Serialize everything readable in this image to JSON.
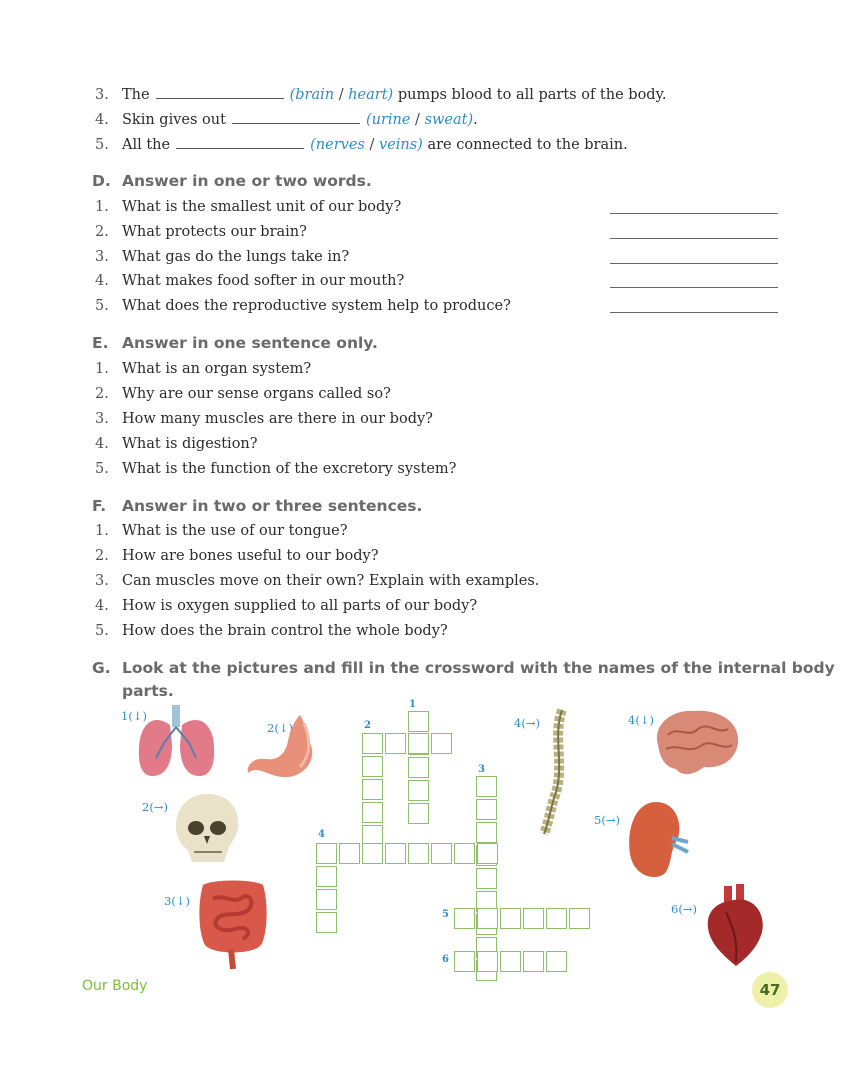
{
  "fill_blanks": [
    {
      "num": "3.",
      "pre": "The",
      "opt1": "brain",
      "opt2": "heart",
      "post": "pumps blood to all parts of the body."
    },
    {
      "num": "4.",
      "pre": "Skin gives out",
      "opt1": "urine",
      "opt2": "sweat",
      "post": "."
    },
    {
      "num": "5.",
      "pre": "All the",
      "opt1": "nerves",
      "opt2": "veins",
      "post": "are connected to the brain."
    }
  ],
  "sections": [
    {
      "letter": "D.",
      "title": "Answer in one or two words.",
      "items": [
        {
          "num": "1.",
          "text": "What is the smallest unit of our body?"
        },
        {
          "num": "2.",
          "text": "What protects our brain?"
        },
        {
          "num": "3.",
          "text": "What gas do the lungs take in?"
        },
        {
          "num": "4.",
          "text": "What makes food softer in our mouth?"
        },
        {
          "num": "5.",
          "text": "What does the reproductive system help to produce?"
        }
      ]
    },
    {
      "letter": "E.",
      "title": "Answer in one sentence only.",
      "items": [
        {
          "num": "1.",
          "text": "What is an organ system?"
        },
        {
          "num": "2.",
          "text": "Why are our sense organs called so?"
        },
        {
          "num": "3.",
          "text": "How many muscles are there in our body?"
        },
        {
          "num": "4.",
          "text": "What is digestion?"
        },
        {
          "num": "5.",
          "text": "What is the function of the excretory system?"
        }
      ]
    },
    {
      "letter": "F.",
      "title": "Answer in two or three sentences.",
      "items": [
        {
          "num": "1.",
          "text": "What is the use of our tongue?"
        },
        {
          "num": "2.",
          "text": "How are bones useful to our body?"
        },
        {
          "num": "3.",
          "text": "Can muscles move on their own? Explain with examples."
        },
        {
          "num": "4.",
          "text": "How is oxygen supplied to all parts of our body?"
        },
        {
          "num": "5.",
          "text": "How does the brain control the whole body?"
        }
      ]
    }
  ],
  "section_g": {
    "letter": "G.",
    "title_line1": "Look at the pictures and fill in the crossword with the names of the internal body",
    "title_line2": "parts."
  },
  "clues": {
    "lungs": "1(↓)",
    "stomach": "2(↓)",
    "skull": "2(→)",
    "intestine": "3(↓)",
    "spine": "4(→)",
    "brain": "4(↓)",
    "kidney": "5(→)",
    "heart": "6(→)"
  },
  "crossword_numbers": {
    "n1": "1",
    "n2": "2",
    "n3": "3",
    "n4": "4",
    "n5": "5",
    "n6": "6"
  },
  "footer": {
    "chapter": "Our Body",
    "page": "47"
  },
  "colors": {
    "accent_blue": "#2a8fc9",
    "heading_gray": "#6a6a6a",
    "grid_green": "#8fbf6a",
    "footer_green": "#7cbf3a"
  }
}
